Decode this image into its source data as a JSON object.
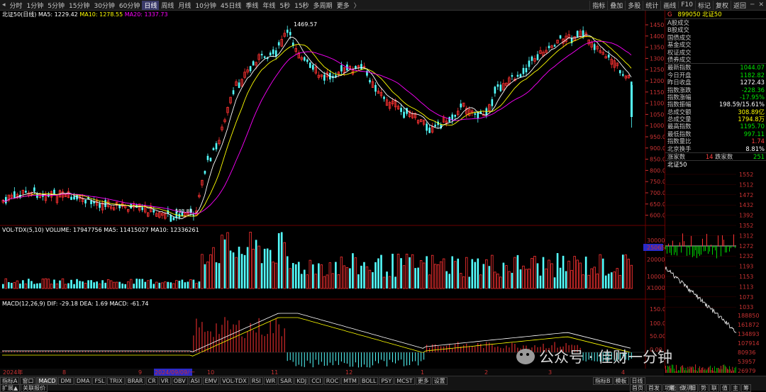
{
  "toolbar": {
    "period_tabs": [
      "分时",
      "1分钟",
      "5分钟",
      "15分钟",
      "30分钟",
      "60分钟",
      "日线",
      "周线",
      "月线",
      "10分钟",
      "45日线",
      "季线",
      "年线",
      "5秒",
      "15秒",
      "多周期",
      "更多"
    ],
    "active_tab": "日线",
    "right_tools": [
      "指标",
      "叠加",
      "多股",
      "统计",
      "画线",
      "F10",
      "标记",
      "复权",
      "返回"
    ]
  },
  "chart": {
    "title": "北证50(日线)",
    "ma": {
      "ma5_label": "MA5: 1229.42",
      "ma10_label": "MA10: 1278.55",
      "ma20_label": "MA20: 1337.73"
    },
    "peak_label": "1469.57",
    "low_label": "593.88",
    "y_ticks": [
      "1450",
      "1400",
      "1350",
      "1300",
      "1250",
      "1200",
      "1150",
      "1100",
      "1050",
      "1000",
      "950.00",
      "900.00",
      "850.00",
      "800.00",
      "750.00",
      "700.00",
      "650.00",
      "600.00"
    ],
    "volume_header": "VOL-TDX(5,10)  VOLUME: 17947756  MA5: 11415027  MA10: 12336261",
    "volume_ticks": [
      "30000",
      "25065",
      "20000",
      "10000",
      "X1000"
    ],
    "macd_header": "MACD(12,26,9)  DIF: -29.18  DEA: 1.69  MACD: -61.74",
    "macd_ticks": [
      "150.0",
      "100.0",
      "50.00",
      "0.00"
    ],
    "x_labels": [
      "2024年",
      "8",
      "9",
      "2024/09/09/一",
      "10",
      "11",
      "12",
      "1",
      "2",
      "3",
      "4"
    ]
  },
  "colors": {
    "up": "#ff3232",
    "down": "#54ffff",
    "ma5": "#ffffff",
    "ma10": "#ffff00",
    "ma20": "#ff00ff",
    "grid": "#6b0000",
    "axis": "#c83232"
  },
  "quote": {
    "code": "899050",
    "name": "北证50",
    "header_marker": "G",
    "category_links": [
      "A股成交",
      "B股成交",
      "国债成交",
      "基金成交",
      "权证成交",
      "债券成交"
    ],
    "rows": [
      {
        "label": "最新指数",
        "value": "1044.07",
        "cls": "down"
      },
      {
        "label": "今日开盘",
        "value": "1182.82",
        "cls": "down"
      },
      {
        "label": "昨日收盘",
        "value": "1272.43",
        "cls": "white"
      },
      {
        "label": "指数涨跌",
        "value": "-228.36",
        "cls": "down"
      },
      {
        "label": "指数涨幅",
        "value": "-17.95%",
        "cls": "down"
      },
      {
        "label": "指数振幅",
        "value": "198.59/15.61%",
        "cls": "white"
      },
      {
        "label": "总成交额",
        "value": "308.89亿",
        "cls": "yellow"
      },
      {
        "label": "总成交量",
        "value": "1794.8万",
        "cls": "yellow"
      },
      {
        "label": "最高指数",
        "value": "1195.70",
        "cls": "down"
      },
      {
        "label": "最低指数",
        "value": "997.11",
        "cls": "down"
      },
      {
        "label": "指数量比",
        "value": "1.74",
        "cls": "up"
      },
      {
        "label": "北京换手",
        "value": "8.81%",
        "cls": "white"
      }
    ],
    "up_count_label": "涨家数",
    "up_count": "14",
    "down_count_label": "跌家数",
    "down_count": "251"
  },
  "intraday": {
    "title": "北证50",
    "price_ticks": [
      "1552",
      "1512",
      "1472",
      "1432",
      "1392",
      "1352",
      "1312",
      "1272",
      "1232",
      "1193",
      "1153",
      "1113",
      "1073",
      "1033"
    ],
    "vol_ticks": [
      "188850",
      "161872",
      "134893",
      "107914",
      "80936",
      "53957",
      "26979"
    ],
    "current_price": "1272"
  },
  "indicator_tabs": [
    "指标A",
    "窗口",
    "MACD",
    "DMI",
    "DMA",
    "FSL",
    "TRIX",
    "BRAR",
    "CR",
    "VR",
    "OBV",
    "ASI",
    "EMV",
    "VOL-TDX",
    "RSI",
    "WR",
    "SAR",
    "KDJ",
    "CCI",
    "ROC",
    "MTM",
    "BOLL",
    "PSY",
    "MCST",
    "更多",
    "设置"
  ],
  "active_indicator": "MACD",
  "bottom_left": [
    "扩展▲",
    "关联报价"
  ],
  "bottom_right": [
    "指标B",
    "模板",
    "日线"
  ],
  "panel_tabs": [
    "笔",
    "价",
    "细",
    "势",
    "联",
    "值",
    "主",
    "筹"
  ],
  "panel_tabs2": [
    "首页",
    "首发",
    "功能",
    "说明"
  ],
  "watermark": "公众号 · 佳财一分钟"
}
